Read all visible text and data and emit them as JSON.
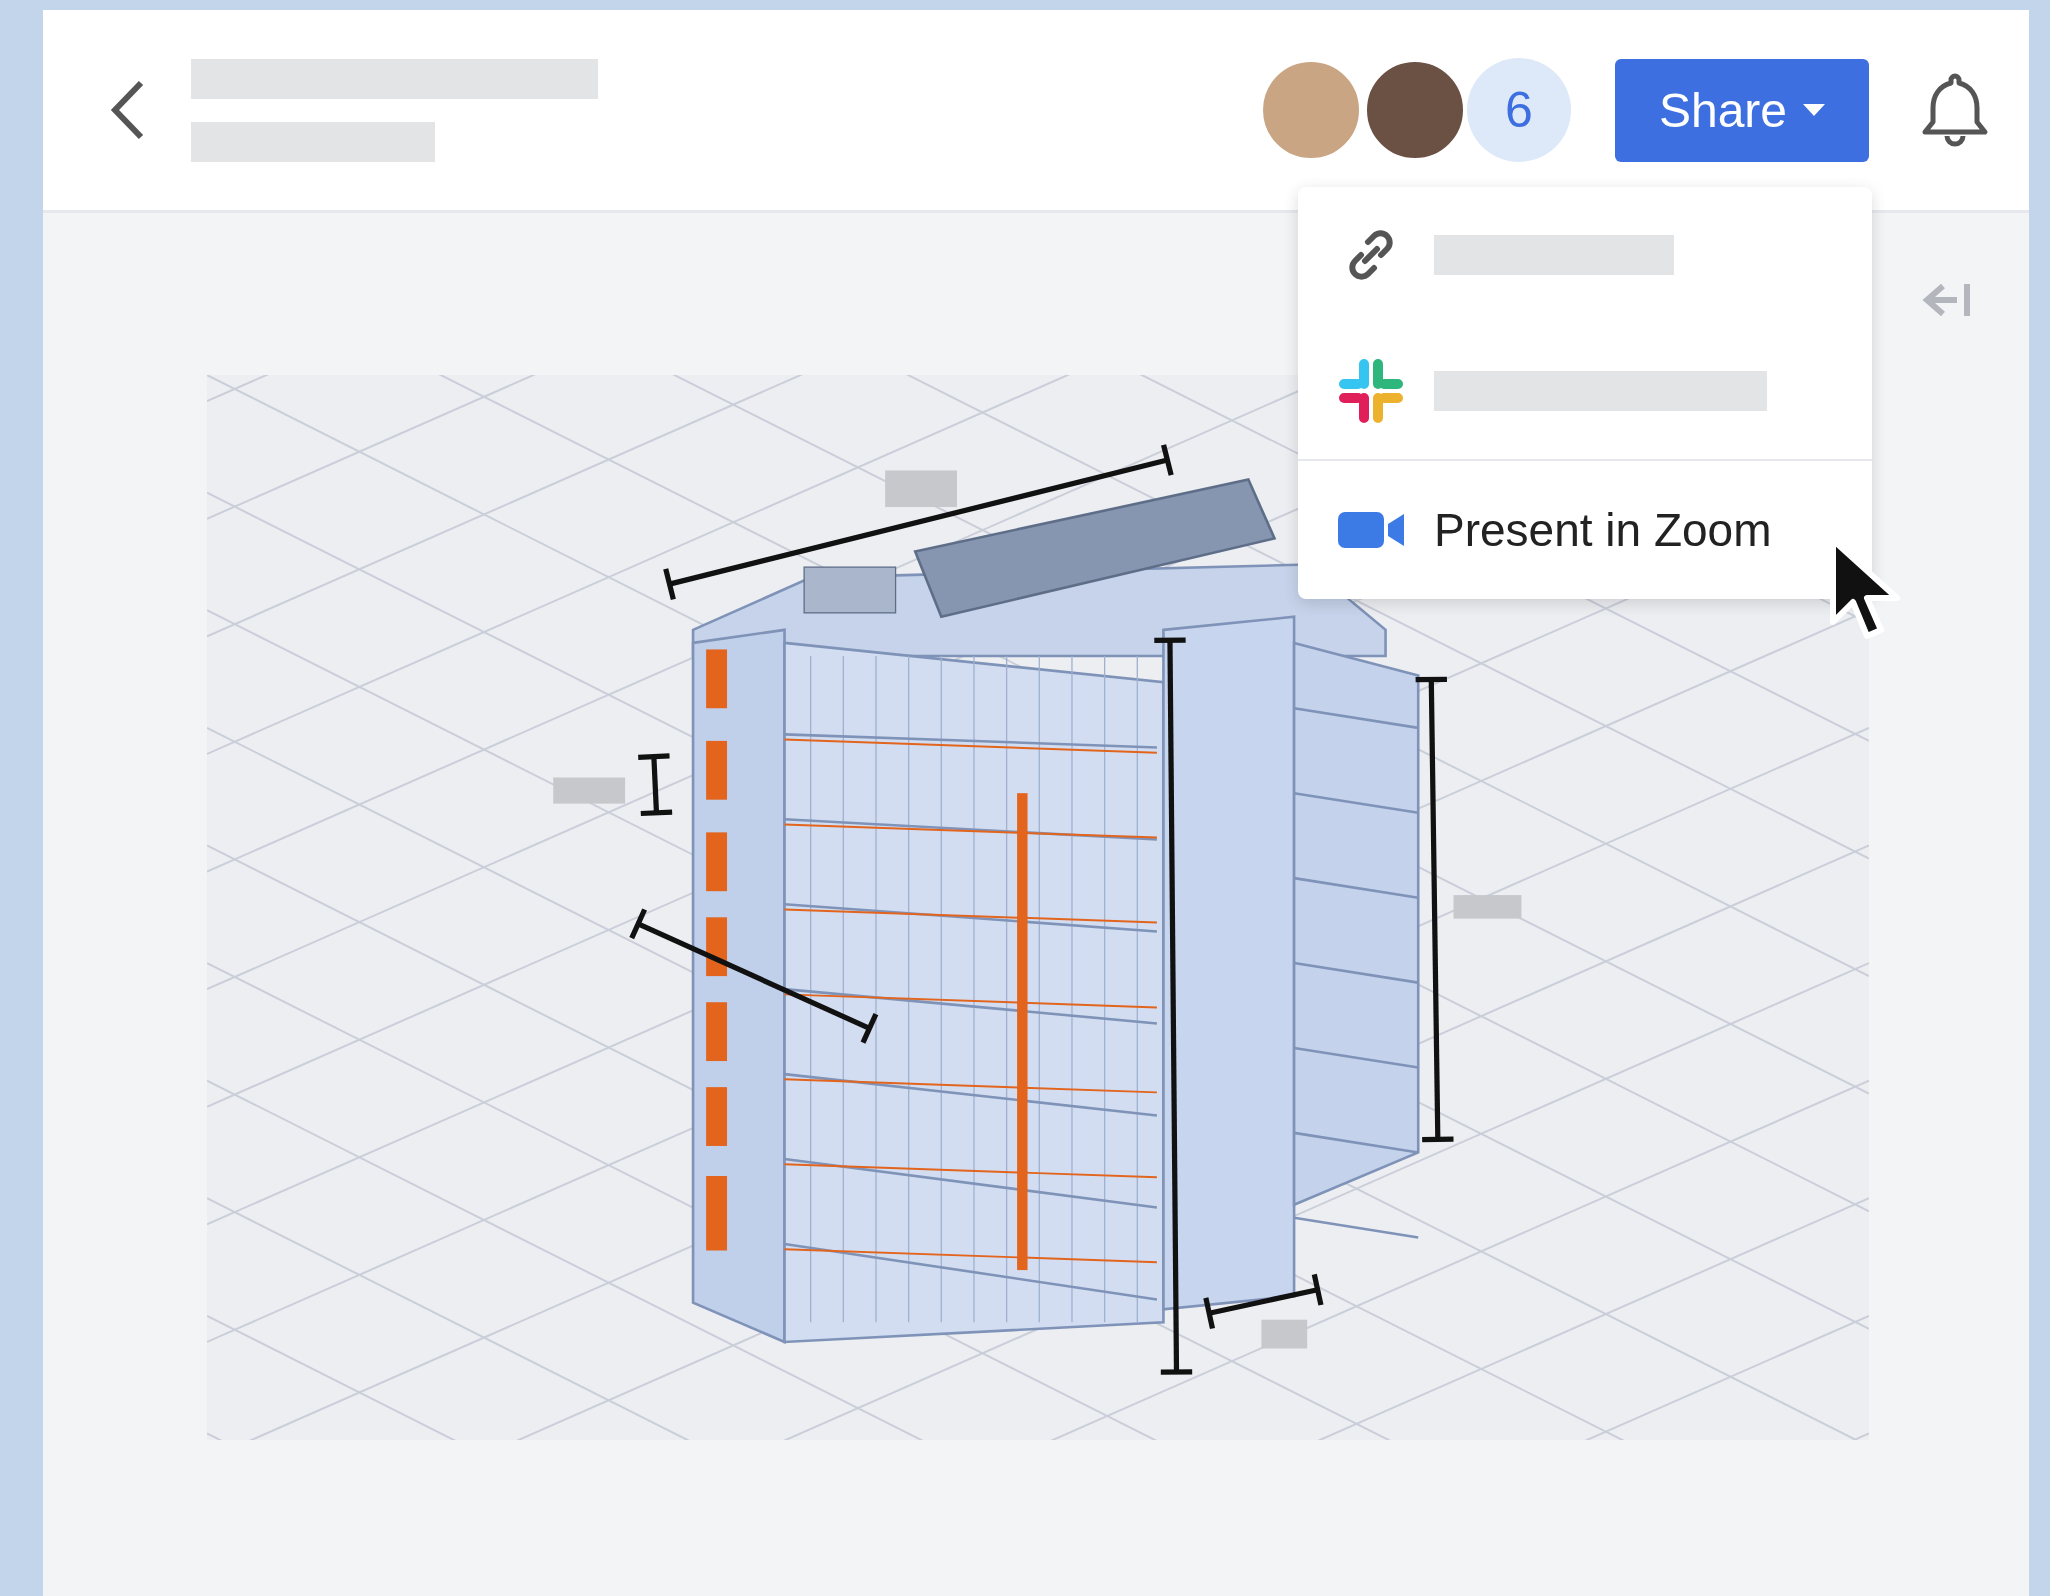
{
  "header": {
    "collaborator_count": "6",
    "share_button": "Share"
  },
  "share_menu": {
    "items": [
      {
        "kind": "link"
      },
      {
        "kind": "slack"
      },
      {
        "kind": "zoom",
        "label": "Present in Zoom"
      }
    ]
  }
}
